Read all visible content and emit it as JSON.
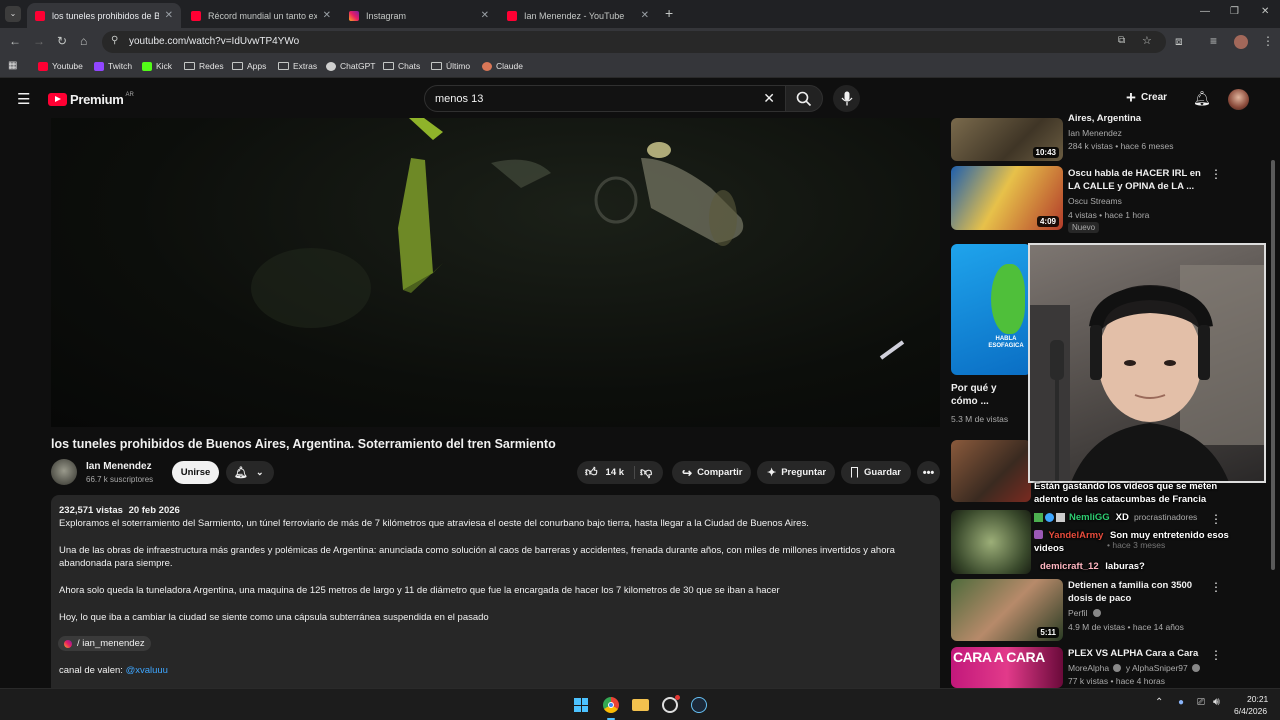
{
  "browser": {
    "tabs": [
      {
        "title": "los tuneles prohibidos de Bueno",
        "icon": "youtube-icon"
      },
      {
        "title": "Récord mundial un tanto extrañ",
        "icon": "youtube-icon"
      },
      {
        "title": "Instagram",
        "icon": "instagram-icon"
      },
      {
        "title": "Ian Menendez - YouTube",
        "icon": "youtube-icon"
      }
    ],
    "new_tab": "+",
    "url": "youtube.com/watch?v=IdUvwTP4YWo",
    "bookmarks": [
      "Youtube",
      "Twitch",
      "Kick",
      "Redes",
      "Apps",
      "Extras",
      "ChatGPT",
      "Chats",
      "Último",
      "Claude"
    ]
  },
  "youtube": {
    "logo": "Premium",
    "region": "AR",
    "search_query": "menos 13",
    "create_label": "Crear"
  },
  "video": {
    "title": "los tuneles prohibidos de Buenos Aires, Argentina. Soterramiento del tren Sarmiento",
    "channel": "Ian Menendez",
    "subscribers": "66.7 k suscriptores",
    "join_label": "Unirse",
    "likes": "14 k",
    "share_label": "Compartir",
    "ask_label": "Preguntar",
    "save_label": "Guardar",
    "views": "232,571 vistas",
    "date": "20 feb 2026",
    "description": [
      "Exploramos el soterramiento del Sarmiento, un túnel ferroviario de más de 7 kilómetros que atraviesa el oeste del conurbano bajo tierra, hasta llegar a la Ciudad de Buenos Aires.",
      "Una de las obras de infraestructura más grandes y polémicas de Argentina: anunciada como solución al caos de barreras y accidentes, frenada durante años, con miles de millones invertidos y ahora abandonada para siempre.",
      "Ahora solo queda la tuneladora Argentina, una maquina de 125 metros de largo y 11 de diámetro que fue la encargada de hacer los 7 kilometros de 30 que se iban a hacer",
      "Hoy, lo que iba a cambiar la ciudad se siente como una cápsula subterránea suspendida en el pasado"
    ],
    "instagram_handle": "/ ian_menendez",
    "valen_label": "canal de valen:",
    "valen_link": "@xvaluuu"
  },
  "sidebar": [
    {
      "title": "Aires, Argentina",
      "channel": "Ian Menendez",
      "meta": "284 k vistas • hace 6 meses",
      "duration": "10:43"
    },
    {
      "title": "Oscu habla de HACER IRL en LA CALLE y OPINA de LA ...",
      "channel": "Oscu Streams",
      "meta": "4 vistas • hace 1 hora",
      "duration": "4:09",
      "badge": "Nuevo"
    },
    {
      "title": "Por qué y cómo ...",
      "meta": "5.3 M de vistas",
      "thumb_text": "HABLA ESOFAGICA"
    },
    {
      "title": "Detienen a familia con 3500 dosis de paco",
      "channel": "Perfil",
      "meta": "4.9 M de vistas • hace 14 años",
      "duration": "5:11"
    },
    {
      "title": "PLEX VS ALPHA Cara a Cara",
      "channel": "MoreAlpha",
      "channel2": "y AlphaSniper97",
      "meta": "77 k vistas • hace 4 horas",
      "thumb_text": "CARA A CARA"
    }
  ],
  "sidebar_partial": {
    "channel": "procrastinadores",
    "meta": "• hace 3 meses"
  },
  "chat": [
    {
      "user": "",
      "text": "Están gastando los videos que se meten adentro de las catacumbas de Francia"
    },
    {
      "user": "NemliGG",
      "text": "XD"
    },
    {
      "user": "YandelArmy",
      "text": "Son muy entretenido esos videos"
    },
    {
      "user": "demicraft_12",
      "text": "laburas?"
    }
  ],
  "taskbar": {
    "time": "20:21",
    "date": "6/4/2026"
  }
}
